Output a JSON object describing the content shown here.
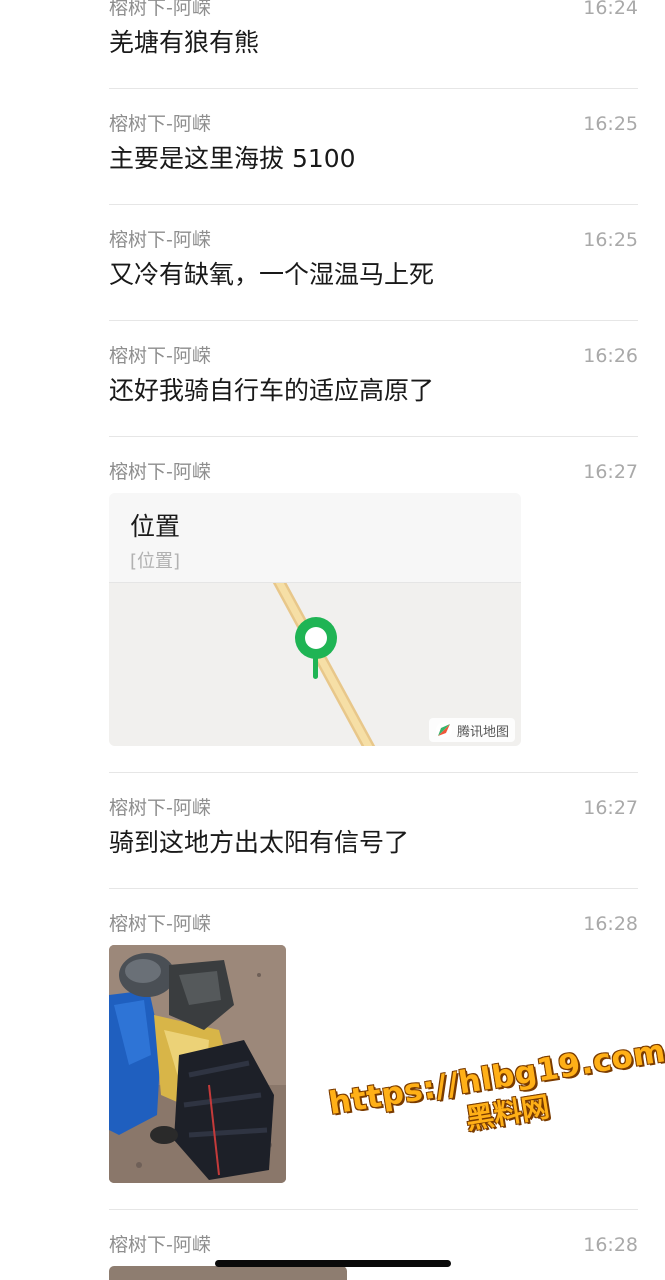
{
  "messages": [
    {
      "sender": "榕树下-阿嵘",
      "time": "16:24",
      "text": "羌塘有狼有熊"
    },
    {
      "sender": "榕树下-阿嵘",
      "time": "16:25",
      "text": "主要是这里海拔 5100"
    },
    {
      "sender": "榕树下-阿嵘",
      "time": "16:25",
      "text": "又冷有缺氧，一个湿温马上死"
    },
    {
      "sender": "榕树下-阿嵘",
      "time": "16:26",
      "text": "还好我骑自行车的适应高原了"
    },
    {
      "sender": "榕树下-阿嵘",
      "time": "16:27",
      "location": {
        "title": "位置",
        "subtitle": "[位置]",
        "map_provider": "腾讯地图",
        "pin_color": "#1fb454"
      }
    },
    {
      "sender": "榕树下-阿嵘",
      "time": "16:27",
      "text": "骑到这地方出太阳有信号了"
    },
    {
      "sender": "榕树下-阿嵘",
      "time": "16:28",
      "image": "photo-gear-on-ground"
    },
    {
      "sender": "榕树下-阿嵘",
      "time": "16:28",
      "image": "photo-partial"
    }
  ],
  "watermark": {
    "url": "https://hlbg19.com",
    "name": "黑料网"
  }
}
